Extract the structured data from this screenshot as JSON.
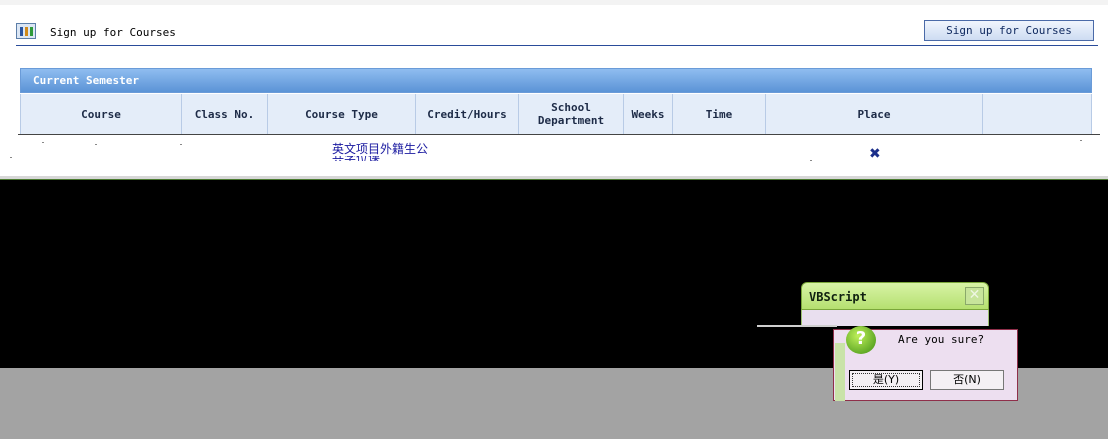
{
  "header": {
    "page_title": "Sign up for Courses",
    "signup_button_label": "Sign up for Courses"
  },
  "semester_panel": {
    "title": "Current Semester",
    "columns": [
      "Course",
      "Class No.",
      "Course Type",
      "Credit/Hours",
      "School Department",
      "Weeks",
      "Time",
      "Place",
      ""
    ],
    "row": {
      "course_type_line1": "英文项目外籍生公",
      "course_type_line2": "共学位课"
    }
  },
  "dialog": {
    "title": "VBScript",
    "message": "Are you sure?",
    "yes_label": "是(Y)",
    "no_label": "否(N)"
  },
  "icons": {
    "app": "table-grid-icon",
    "delete": "delete-x-icon",
    "dialog": "question-icon",
    "close": "close-icon"
  },
  "colors": {
    "header_gradient_top": "#8fbdf0",
    "header_gradient_bottom": "#5b93d6",
    "column_header_bg": "#e4edf9",
    "dialog_title_bg": "#b5e070",
    "delete_icon": "#1b2f8a"
  }
}
